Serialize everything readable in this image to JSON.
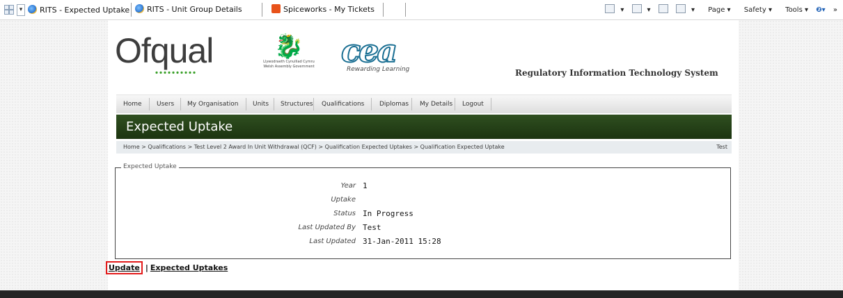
{
  "browser": {
    "tabs": [
      {
        "label": "RITS - Expected Uptake",
        "icon": "ie-icon",
        "closable": true
      },
      {
        "label": "RITS - Unit Group Details",
        "icon": "ie-icon"
      },
      {
        "label": "Spiceworks - My Tickets",
        "icon": "spiceworks-icon"
      }
    ],
    "commands": {
      "page": "Page",
      "safety": "Safety",
      "tools": "Tools"
    }
  },
  "header": {
    "brand": "Ofqual",
    "welsh_caption": "Llywodraeth Cynulliad Cymru Welsh Assembly Government",
    "partner_tagline": "Rewarding Learning",
    "system_title": "Regulatory Information Technology System"
  },
  "nav": {
    "items": [
      "Home",
      "Users",
      "My Organisation",
      "Units",
      "Structures",
      "Qualifications",
      "Diplomas",
      "My Details",
      "Logout"
    ]
  },
  "page": {
    "title": "Expected Uptake",
    "breadcrumb": "Home > Qualifications > Test Level 2 Award In Unit Withdrawal (QCF) > Qualification Expected Uptakes > Qualification Expected Uptake",
    "user": "Test"
  },
  "details": {
    "legend": "Expected Uptake",
    "fields": [
      {
        "label": "Year",
        "value": "1"
      },
      {
        "label": "Uptake",
        "value": ""
      },
      {
        "label": "Status",
        "value": "In Progress"
      },
      {
        "label": "Last Updated By",
        "value": "Test"
      },
      {
        "label": "Last Updated",
        "value": "31-Jan-2011 15:28"
      }
    ]
  },
  "actions": {
    "update": "Update",
    "separator": "|",
    "expected_uptakes": "Expected Uptakes",
    "highlight_color": "#e31a1a"
  }
}
